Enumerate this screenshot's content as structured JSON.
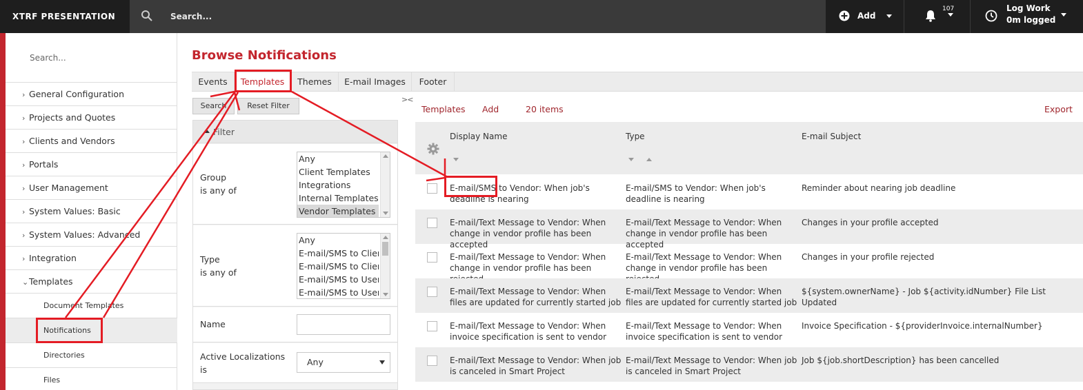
{
  "topbar": {
    "brand": "XTRF PRESENTATION",
    "search_placeholder": "Search...",
    "add_label": "Add",
    "notifications_count": "107",
    "logwork_line1": "Log Work",
    "logwork_line2": "0m logged"
  },
  "sidebar": {
    "search_placeholder": "Search...",
    "items": [
      {
        "label": "General Configuration",
        "chevron": "›"
      },
      {
        "label": "Projects and Quotes",
        "chevron": "›"
      },
      {
        "label": "Clients and Vendors",
        "chevron": "›"
      },
      {
        "label": "Portals",
        "chevron": "›"
      },
      {
        "label": "User Management",
        "chevron": "›"
      },
      {
        "label": "System Values: Basic",
        "chevron": "›"
      },
      {
        "label": "System Values: Advanced",
        "chevron": "›"
      },
      {
        "label": "Integration",
        "chevron": "›"
      },
      {
        "label": "Templates",
        "chevron": "⌄"
      }
    ],
    "subitems": [
      {
        "label": "Document Templates"
      },
      {
        "label": "Notifications"
      },
      {
        "label": "Directories"
      },
      {
        "label": "Files"
      }
    ]
  },
  "page": {
    "title": "Browse Notifications",
    "tabs": [
      {
        "label": "Events"
      },
      {
        "label": "Templates"
      },
      {
        "label": "Themes"
      },
      {
        "label": "E-mail Images"
      },
      {
        "label": "Footer"
      }
    ],
    "search_button": "Search",
    "reset_button": "Reset Filter",
    "collapse_glyph": "><"
  },
  "filter": {
    "title": "Filter",
    "group_label1": "Group",
    "group_label2": "is any of",
    "group_options": [
      "Any",
      "Client Templates",
      "Integrations",
      "Internal Templates",
      "Vendor Templates"
    ],
    "type_label1": "Type",
    "type_label2": "is any of",
    "type_options": [
      "Any",
      "E-mail/SMS to Client",
      "E-mail/SMS to Client",
      "E-mail/SMS to User",
      "E-mail/SMS to User"
    ],
    "name_label": "Name",
    "name_value": "",
    "loc_label1": "Active Localizations",
    "loc_label2": "is",
    "loc_value": "Any"
  },
  "results": {
    "templates_link": "Templates",
    "add_link": "Add",
    "count": "20 items",
    "export": "Export",
    "columns": [
      "Display Name",
      "Type",
      "E-mail Subject"
    ],
    "rows": [
      {
        "name": "E-mail/SMS to Vendor: When job's deadline is nearing",
        "type": "E-mail/SMS to Vendor: When job's deadline is nearing",
        "subject": "Reminder about nearing job deadline"
      },
      {
        "name": "E-mail/Text Message to Vendor: When change in vendor profile has been accepted",
        "type": "E-mail/Text Message to Vendor: When change in vendor profile has been accepted",
        "subject": "Changes in your profile accepted"
      },
      {
        "name": "E-mail/Text Message to Vendor: When change in vendor profile has been rejected",
        "type": "E-mail/Text Message to Vendor: When change in vendor profile has been rejected",
        "subject": "Changes in your profile rejected"
      },
      {
        "name": "E-mail/Text Message to Vendor: When files are updated for currently started job",
        "type": "E-mail/Text Message to Vendor: When files are updated for currently started job",
        "subject": "${system.ownerName} - Job ${activity.idNumber} File List Updated"
      },
      {
        "name": "E-mail/Text Message to Vendor: When invoice specification is sent to vendor",
        "type": "E-mail/Text Message to Vendor: When invoice specification is sent to vendor",
        "subject": "Invoice Specification - ${providerInvoice.internalNumber}"
      },
      {
        "name": "E-mail/Text Message to Vendor: When job is canceled in Smart Project",
        "type": "E-mail/Text Message to Vendor: When job is canceled in Smart Project",
        "subject": "Job ${job.shortDescription} has been cancelled"
      }
    ]
  },
  "colors": {
    "accent": "#c3262e",
    "annotation": "#e41c24",
    "topbar": "#3a3a3a"
  }
}
